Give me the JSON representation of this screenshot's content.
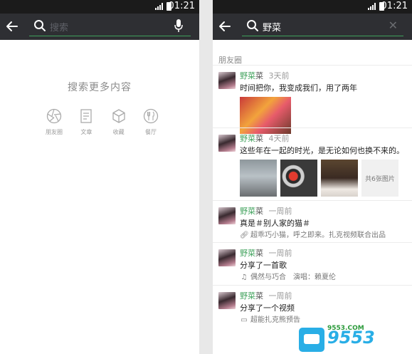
{
  "status_bar": {
    "time": "01:21"
  },
  "left_screen": {
    "search": {
      "placeholder": "搜索"
    },
    "hint": "搜索更多内容",
    "categories": [
      {
        "label": "朋友圈",
        "icon": "aperture-icon"
      },
      {
        "label": "文章",
        "icon": "document-icon"
      },
      {
        "label": "收藏",
        "icon": "cube-icon"
      },
      {
        "label": "餐厅",
        "icon": "fork-knife-icon"
      }
    ]
  },
  "right_screen": {
    "search": {
      "query": "野菜"
    },
    "section_title": "朋友圈",
    "results": [
      {
        "name_match": "野菜",
        "name_rest": "菜",
        "time": "3天前",
        "text": "时间把你，我变成我们，用了两年",
        "kind": "photo_single"
      },
      {
        "name_match": "野菜",
        "name_rest": "菜",
        "time": "4天前",
        "text": "这些年在一起的时光，是无论如何也换不来的。",
        "kind": "photo_grid",
        "more_label": "共6张图片"
      },
      {
        "name_match": "野菜",
        "name_rest": "菜",
        "time": "一周前",
        "text": "真是＃别人家的猫＃",
        "kind": "link",
        "sub": "超乖巧小猫，呼之即来。扎克视频联合出品",
        "sub_icon": "link-icon"
      },
      {
        "name_match": "野菜",
        "name_rest": "菜",
        "time": "一周前",
        "text": "分享了一首歌",
        "kind": "music",
        "sub": "偶然与巧合　演唱：赖夏伦",
        "sub_icon": "music-note-icon"
      },
      {
        "name_match": "野菜",
        "name_rest": "菜",
        "time": "一周前",
        "text": "分享了一个视频",
        "kind": "video",
        "sub": "超能扎克熊预告",
        "sub_icon": "video-icon"
      }
    ]
  },
  "watermark": {
    "brand": "9553",
    "url": "9553.COM"
  },
  "colors": {
    "toolbar": "#2e2f33",
    "accent": "#3fa15b",
    "statusbar": "#1b1b1b"
  }
}
